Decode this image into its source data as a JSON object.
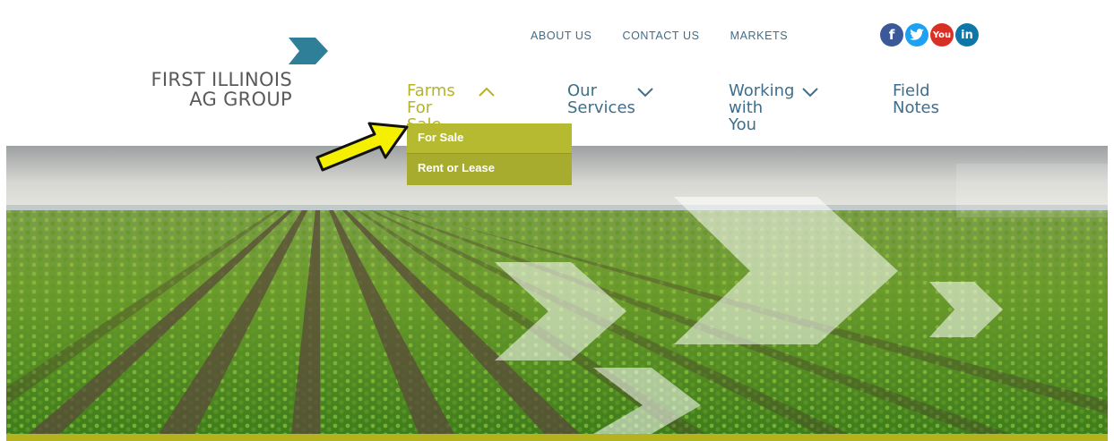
{
  "logo": {
    "line1": "FIRST ILLINOIS",
    "line2": "AG GROUP",
    "icon": "chevron-logo-icon"
  },
  "utility_nav": [
    "ABOUT US",
    "CONTACT US",
    "MARKETS"
  ],
  "social": [
    {
      "name": "facebook-icon",
      "glyph": "f"
    },
    {
      "name": "twitter-icon",
      "glyph": "t"
    },
    {
      "name": "youtube-icon",
      "glyph": "You"
    },
    {
      "name": "linkedin-icon",
      "glyph": "in"
    }
  ],
  "main_nav": [
    {
      "line1": "Farms",
      "line2": "For Sale",
      "chevron": "up"
    },
    {
      "line1": "Our",
      "line2": "Services",
      "chevron": "down"
    },
    {
      "line1": "Working",
      "line2": "with You",
      "chevron": "down"
    },
    {
      "line1": "Field",
      "line2": "Notes",
      "chevron": "none"
    }
  ],
  "dropdown": {
    "items": [
      "For Sale",
      "Rent or Lease"
    ]
  },
  "colors": {
    "accent_olive": "#b5b32a",
    "nav_blue": "#3f6e8a",
    "logo_teal": "#2e7f97",
    "dropdown_bg": "#a7ab2e",
    "callout_yellow": "#f4f000"
  }
}
